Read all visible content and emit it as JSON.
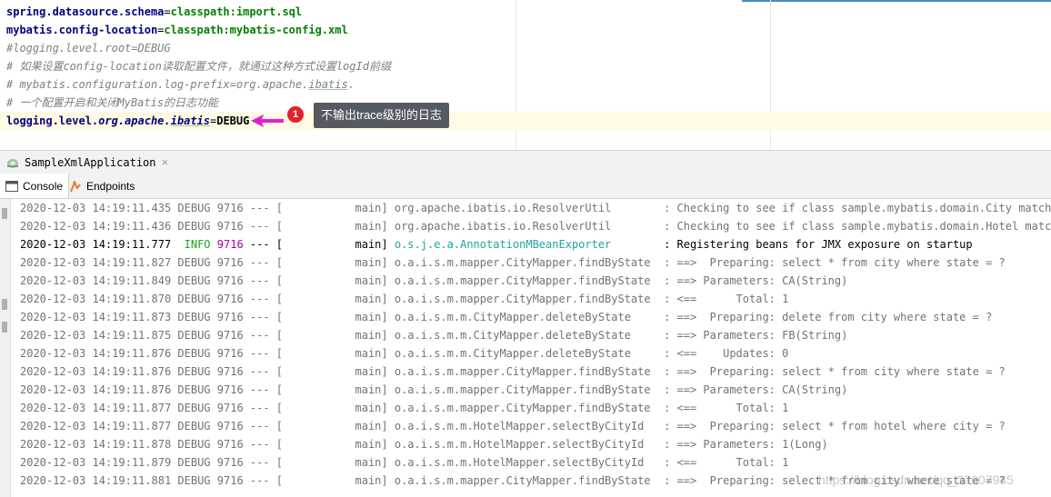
{
  "editor": {
    "lines": [
      {
        "key": "spring.datasource.schema",
        "eq": "=",
        "val": "classpath:import.sql"
      },
      {
        "key": "mybatis.config-location",
        "eq": "=",
        "val": "classpath:mybatis-config.xml"
      },
      {
        "comment": "#logging.level.root=DEBUG"
      },
      {
        "comment": "# 如果设置config-location读取配置文件，就通过这种方式设置logId前缀"
      },
      {
        "comment_pre": "# mybatis.configuration.log-prefix=org.apache.",
        "comment_ib": "ibatis",
        "comment_post": "."
      },
      {
        "comment": "# 一个配置开启和关闭MyBatis的日志功能"
      },
      {
        "key_pre": "logging.level.",
        "key_it": "org.apache.",
        "key_ib": "ibatis",
        "eq": "=",
        "val": "DEBUG"
      }
    ]
  },
  "annotation": {
    "badge": "1",
    "tooltip": "不输出trace级别的日志",
    "arrow_color": "#e020d0",
    "badge_color": "#e0222a"
  },
  "run_tab": {
    "label": "SampleXmlApplication",
    "close": "×",
    "icon": "run-app-icon"
  },
  "console_tabs": [
    {
      "label": "Console",
      "icon": "console-icon",
      "active": true
    },
    {
      "label": "Endpoints",
      "icon": "endpoints-icon",
      "active": false
    }
  ],
  "log": [
    {
      "ts": "2020-12-03 14:19:11.435",
      "lvl": "DEBUG",
      "pid": "9716",
      "sep": " --- [",
      "thread": "           main]",
      "cls": " org.apache.ibatis.io.ResolverUtil       ",
      "msg": " : Checking to see if class sample.mybatis.domain.City matches cr"
    },
    {
      "ts": "2020-12-03 14:19:11.436",
      "lvl": "DEBUG",
      "pid": "9716",
      "sep": " --- [",
      "thread": "           main]",
      "cls": " org.apache.ibatis.io.ResolverUtil       ",
      "msg": " : Checking to see if class sample.mybatis.domain.Hotel matches c"
    },
    {
      "ts": "2020-12-03 14:19:11.777",
      "lvl": " INFO",
      "pid": "9716",
      "sep": " --- [",
      "thread": "           main]",
      "cls": " o.s.j.e.a.AnnotationMBeanExporter       ",
      "msg": " : Registering beans for JMX exposure on startup",
      "info": true
    },
    {
      "ts": "2020-12-03 14:19:11.827",
      "lvl": "DEBUG",
      "pid": "9716",
      "sep": " --- [",
      "thread": "           main]",
      "cls": " o.a.i.s.m.mapper.CityMapper.findByState ",
      "msg": " : ==>  Preparing: select * from city where state = ?"
    },
    {
      "ts": "2020-12-03 14:19:11.849",
      "lvl": "DEBUG",
      "pid": "9716",
      "sep": " --- [",
      "thread": "           main]",
      "cls": " o.a.i.s.m.mapper.CityMapper.findByState ",
      "msg": " : ==> Parameters: CA(String)"
    },
    {
      "ts": "2020-12-03 14:19:11.870",
      "lvl": "DEBUG",
      "pid": "9716",
      "sep": " --- [",
      "thread": "           main]",
      "cls": " o.a.i.s.m.mapper.CityMapper.findByState ",
      "msg": " : <==      Total: 1"
    },
    {
      "ts": "2020-12-03 14:19:11.873",
      "lvl": "DEBUG",
      "pid": "9716",
      "sep": " --- [",
      "thread": "           main]",
      "cls": " o.a.i.s.m.m.CityMapper.deleteByState    ",
      "msg": " : ==>  Preparing: delete from city where state = ?"
    },
    {
      "ts": "2020-12-03 14:19:11.875",
      "lvl": "DEBUG",
      "pid": "9716",
      "sep": " --- [",
      "thread": "           main]",
      "cls": " o.a.i.s.m.m.CityMapper.deleteByState    ",
      "msg": " : ==> Parameters: FB(String)"
    },
    {
      "ts": "2020-12-03 14:19:11.876",
      "lvl": "DEBUG",
      "pid": "9716",
      "sep": " --- [",
      "thread": "           main]",
      "cls": " o.a.i.s.m.m.CityMapper.deleteByState    ",
      "msg": " : <==    Updates: 0"
    },
    {
      "ts": "2020-12-03 14:19:11.876",
      "lvl": "DEBUG",
      "pid": "9716",
      "sep": " --- [",
      "thread": "           main]",
      "cls": " o.a.i.s.m.mapper.CityMapper.findByState ",
      "msg": " : ==>  Preparing: select * from city where state = ?"
    },
    {
      "ts": "2020-12-03 14:19:11.876",
      "lvl": "DEBUG",
      "pid": "9716",
      "sep": " --- [",
      "thread": "           main]",
      "cls": " o.a.i.s.m.mapper.CityMapper.findByState ",
      "msg": " : ==> Parameters: CA(String)"
    },
    {
      "ts": "2020-12-03 14:19:11.877",
      "lvl": "DEBUG",
      "pid": "9716",
      "sep": " --- [",
      "thread": "           main]",
      "cls": " o.a.i.s.m.mapper.CityMapper.findByState ",
      "msg": " : <==      Total: 1"
    },
    {
      "ts": "2020-12-03 14:19:11.877",
      "lvl": "DEBUG",
      "pid": "9716",
      "sep": " --- [",
      "thread": "           main]",
      "cls": " o.a.i.s.m.m.HotelMapper.selectByCityId  ",
      "msg": " : ==>  Preparing: select * from hotel where city = ?"
    },
    {
      "ts": "2020-12-03 14:19:11.878",
      "lvl": "DEBUG",
      "pid": "9716",
      "sep": " --- [",
      "thread": "           main]",
      "cls": " o.a.i.s.m.m.HotelMapper.selectByCityId  ",
      "msg": " : ==> Parameters: 1(Long)"
    },
    {
      "ts": "2020-12-03 14:19:11.879",
      "lvl": "DEBUG",
      "pid": "9716",
      "sep": " --- [",
      "thread": "           main]",
      "cls": " o.a.i.s.m.m.HotelMapper.selectByCityId  ",
      "msg": " : <==      Total: 1"
    },
    {
      "ts": "2020-12-03 14:19:11.881",
      "lvl": "DEBUG",
      "pid": "9716",
      "sep": " --- [",
      "thread": "           main]",
      "cls": " o.a.i.s.m.mapper.CityMapper.findByState ",
      "msg": " : ==>  Preparing: select * from city where state = ?"
    }
  ],
  "watermark": "https://blog.csdn.net/qq_37607945"
}
